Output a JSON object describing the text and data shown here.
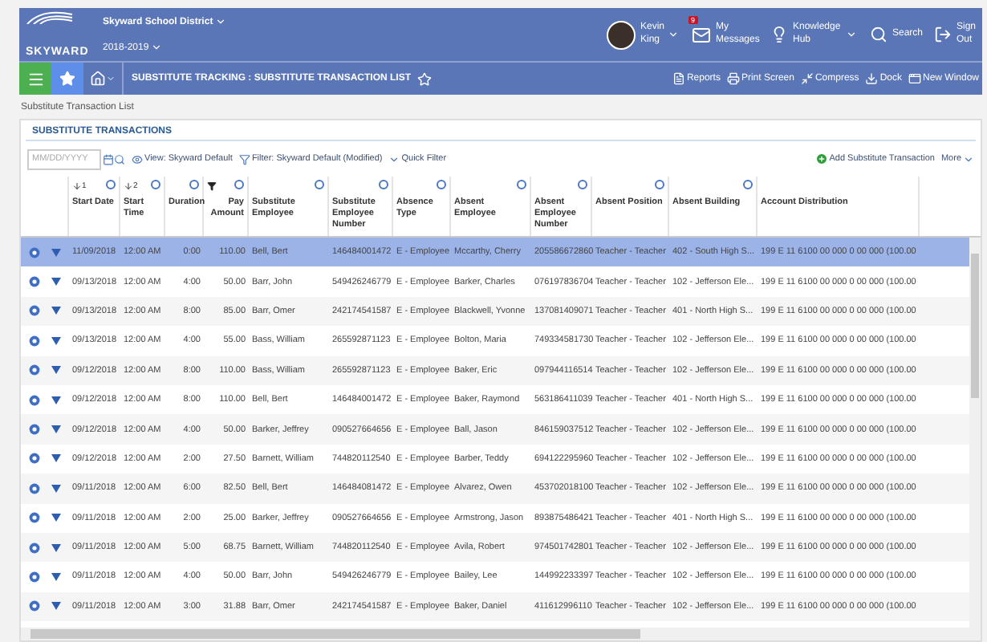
{
  "header": {
    "logo": "SKYWARD",
    "district": "Skyward School District",
    "year": "2018-2019",
    "user": "Kevin King",
    "messages": {
      "label": "My Messages",
      "badge": "9"
    },
    "knowledge": "Knowledge Hub",
    "search": "Search",
    "signout": "Sign Out"
  },
  "navbar": {
    "title": "SUBSTITUTE TRACKING : SUBSTITUTE TRANSACTION LIST",
    "favorite": false,
    "actions": [
      "Reports",
      "Print Screen",
      "Compress",
      "Dock",
      "New Window"
    ]
  },
  "breadcrumb": "Substitute Transaction List",
  "panel": {
    "title": "SUBSTITUTE TRANSACTIONS",
    "date": {
      "placeholder": "MM/DD/YYYY"
    },
    "view": "View: Skyward Default",
    "filter": "Filter: Skyward Default (Modified)",
    "quick_filter": "Quick Filter",
    "add": "Add Substitute Transaction",
    "more": "More"
  },
  "table": {
    "columns": [
      {
        "label": "Start Date",
        "sort": "1",
        "filtered": false,
        "menu": true
      },
      {
        "label": "Start Time",
        "sort": "2",
        "filtered": false,
        "menu": true
      },
      {
        "label": "Duration",
        "filtered": false,
        "menu": true
      },
      {
        "label": "Pay Amount",
        "filtered": true,
        "menu": true
      },
      {
        "label": "Substitute Employee",
        "filtered": false,
        "menu": true
      },
      {
        "label": "Substitute Employee Number",
        "filtered": false,
        "menu": true
      },
      {
        "label": "Absence Type",
        "filtered": false,
        "menu": true
      },
      {
        "label": "Absent Employee",
        "filtered": false,
        "menu": true
      },
      {
        "label": "Absent Employee Number",
        "filtered": false,
        "menu": true
      },
      {
        "label": "Absent Position",
        "filtered": false,
        "menu": true
      },
      {
        "label": "Absent Building",
        "filtered": false,
        "menu": true
      },
      {
        "label": "Account Distribution",
        "filtered": false,
        "menu": false
      }
    ],
    "rows": [
      {
        "selected": true,
        "cells": [
          "11/09/2018",
          "12:00 AM",
          "0:00",
          "110.00",
          "Bell, Bert",
          "146484001472",
          "E - Employee",
          "Mccarthy, Cherry",
          "205586672860",
          "Teacher - Teacher",
          "402 - South High S...",
          "199 E 11 6100 00 000 0 00 000 (100.00"
        ]
      },
      {
        "selected": false,
        "cells": [
          "09/13/2018",
          "12:00 AM",
          "4:00",
          "50.00",
          "Barr, John",
          "549426246779",
          "E - Employee",
          "Barker, Charles",
          "076197836704",
          "Teacher - Teacher",
          "102 - Jefferson Ele...",
          "199 E 11 6100 00 000 0 00 000 (100.00"
        ]
      },
      {
        "selected": false,
        "cells": [
          "09/13/2018",
          "12:00 AM",
          "8:00",
          "85.00",
          "Barr, Omer",
          "242174541587",
          "E - Employee",
          "Blackwell, Yvonne",
          "137081409071",
          "Teacher - Teacher",
          "401 - North High S...",
          "199 E 11 6100 00 000 0 00 000 (100.00"
        ]
      },
      {
        "selected": false,
        "cells": [
          "09/13/2018",
          "12:00 AM",
          "4:00",
          "55.00",
          "Bass, William",
          "265592871123",
          "E - Employee",
          "Bolton, Maria",
          "749334581730",
          "Teacher - Teacher",
          "102 - Jefferson Ele...",
          "199 E 11 6100 00 000 0 00 000 (100.00"
        ]
      },
      {
        "selected": false,
        "cells": [
          "09/12/2018",
          "12:00 AM",
          "8:00",
          "110.00",
          "Bass, William",
          "265592871123",
          "E - Employee",
          "Baker, Eric",
          "097944116514",
          "Teacher - Teacher",
          "102 - Jefferson Ele...",
          "199 E 11 6100 00 000 0 00 000 (100.00"
        ]
      },
      {
        "selected": false,
        "cells": [
          "09/12/2018",
          "12:00 AM",
          "8:00",
          "110.00",
          "Bell, Bert",
          "146484001472",
          "E - Employee",
          "Baker, Raymond",
          "563186411039",
          "Teacher - Teacher",
          "401 - North High S...",
          "199 E 11 6100 00 000 0 00 000 (100.00"
        ]
      },
      {
        "selected": false,
        "cells": [
          "09/12/2018",
          "12:00 AM",
          "4:00",
          "50.00",
          "Barker, Jeffrey",
          "090527664656",
          "E - Employee",
          "Ball, Jason",
          "846159037512",
          "Teacher - Teacher",
          "102 - Jefferson Ele...",
          "199 E 11 6100 00 000 0 00 000 (100.00"
        ]
      },
      {
        "selected": false,
        "cells": [
          "09/12/2018",
          "12:00 AM",
          "2:00",
          "27.50",
          "Barnett, William",
          "744820112540",
          "E - Employee",
          "Barber, Teddy",
          "694122295960",
          "Teacher - Teacher",
          "102 - Jefferson Ele...",
          "199 E 11 6100 00 000 0 00 000 (100.00"
        ]
      },
      {
        "selected": false,
        "cells": [
          "09/11/2018",
          "12:00 AM",
          "6:00",
          "82.50",
          "Bell, Bert",
          "146484081472",
          "E - Employee",
          "Alvarez, Owen",
          "453702018100",
          "Teacher - Teacher",
          "102 - Jefferson Ele...",
          "199 E 11 6100 00 000 0 00 000 (100.00"
        ]
      },
      {
        "selected": false,
        "cells": [
          "09/11/2018",
          "12:00 AM",
          "2:00",
          "25.00",
          "Barker, Jeffrey",
          "090527664656",
          "E - Employee",
          "Armstrong, Jason",
          "893875486421",
          "Teacher - Teacher",
          "401 - North High S...",
          "199 E 11 6100 00 000 0 00 000 (100.00"
        ]
      },
      {
        "selected": false,
        "cells": [
          "09/11/2018",
          "12:00 AM",
          "5:00",
          "68.75",
          "Barnett, William",
          "744820112540",
          "E - Employee",
          "Avila, Robert",
          "974501742801",
          "Teacher - Teacher",
          "102 - Jefferson Ele...",
          "199 E 11 6100 00 000 0 00 000 (100.00"
        ]
      },
      {
        "selected": false,
        "cells": [
          "09/11/2018",
          "12:00 AM",
          "4:00",
          "50.00",
          "Barr, John",
          "549426246779",
          "E - Employee",
          "Bailey, Lee",
          "144992233397",
          "Teacher - Teacher",
          "102 - Jefferson Ele...",
          "199 E 11 6100 00 000 0 00 000 (100.00"
        ]
      },
      {
        "selected": false,
        "cells": [
          "09/11/2018",
          "12:00 AM",
          "3:00",
          "31.88",
          "Barr, Omer",
          "242174541587",
          "E - Employee",
          "Baker, Daniel",
          "411612996110",
          "Teacher - Teacher",
          "102 - Jefferson Ele...",
          "199 E 11 6100 00 000 0 00 000 (100.00"
        ]
      }
    ]
  }
}
